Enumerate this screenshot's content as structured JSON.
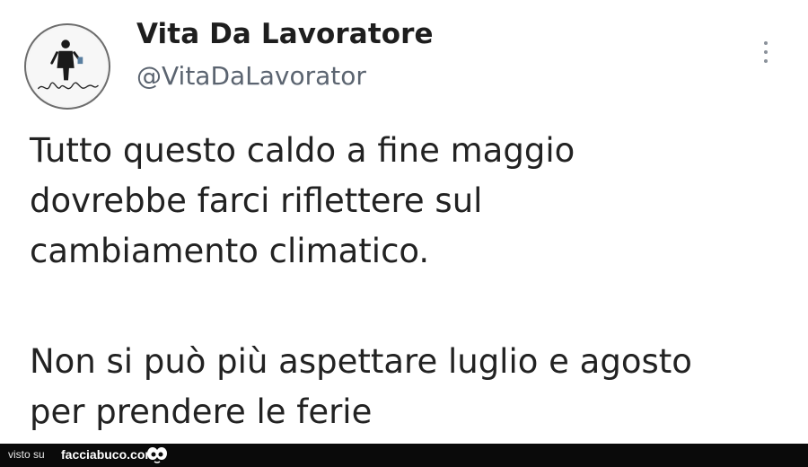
{
  "tweet": {
    "display_name": "Vita Da Lavoratore",
    "handle": "@VitaDaLavorator",
    "avatar_icon": "avatar-logo-icon",
    "more_icon": "more-options-icon",
    "paragraph1": [
      "Tutto questo caldo a fine maggio",
      "dovrebbe farci riflettere sul",
      "cambiamento climatico."
    ],
    "paragraph2": [
      "Non si può più aspettare luglio e agosto",
      "per prendere le ferie"
    ]
  },
  "footer": {
    "label": "visto su",
    "site": "facciabuco.com",
    "logo_icon": "eyes-icon"
  }
}
